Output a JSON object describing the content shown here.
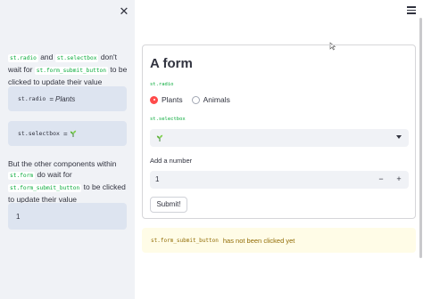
{
  "sidebar": {
    "para1": {
      "code1": "st.radio",
      "and": "and",
      "code2": "st.selectbox",
      "text1": "don't wait for",
      "code3": "st.form_submit_button",
      "text2": "to be clicked to update their value"
    },
    "radio_box": {
      "code": "st.radio",
      "eq": "=",
      "value": "Plants"
    },
    "select_box": {
      "code": "st.selectbox",
      "eq": "="
    },
    "para2": {
      "text1": "But the other components within",
      "code1": "st.form",
      "text2": "do wait for",
      "code2": "st.form_submit_button",
      "text3": "to be clicked to update their value"
    },
    "number_box": {
      "value": "1"
    }
  },
  "form": {
    "title": "A form",
    "radio_label": "st.radio",
    "radio_options": [
      "Plants",
      "Animals"
    ],
    "radio_selected": "Plants",
    "select_label": "st.selectbox",
    "select_value_icon": "seedling-icon",
    "number_label": "Add a number",
    "number_value": "1",
    "minus": "−",
    "plus": "+",
    "submit_label": "Submit!"
  },
  "warning": {
    "code": "st.form_submit_button",
    "text": "has not been clicked yet"
  },
  "colors": {
    "accent": "#ff4b4b",
    "code_green": "#09ab3b",
    "sidebar_bg": "#f0f2f6",
    "warn_bg": "#fffce7",
    "warn_text": "#926c05"
  }
}
